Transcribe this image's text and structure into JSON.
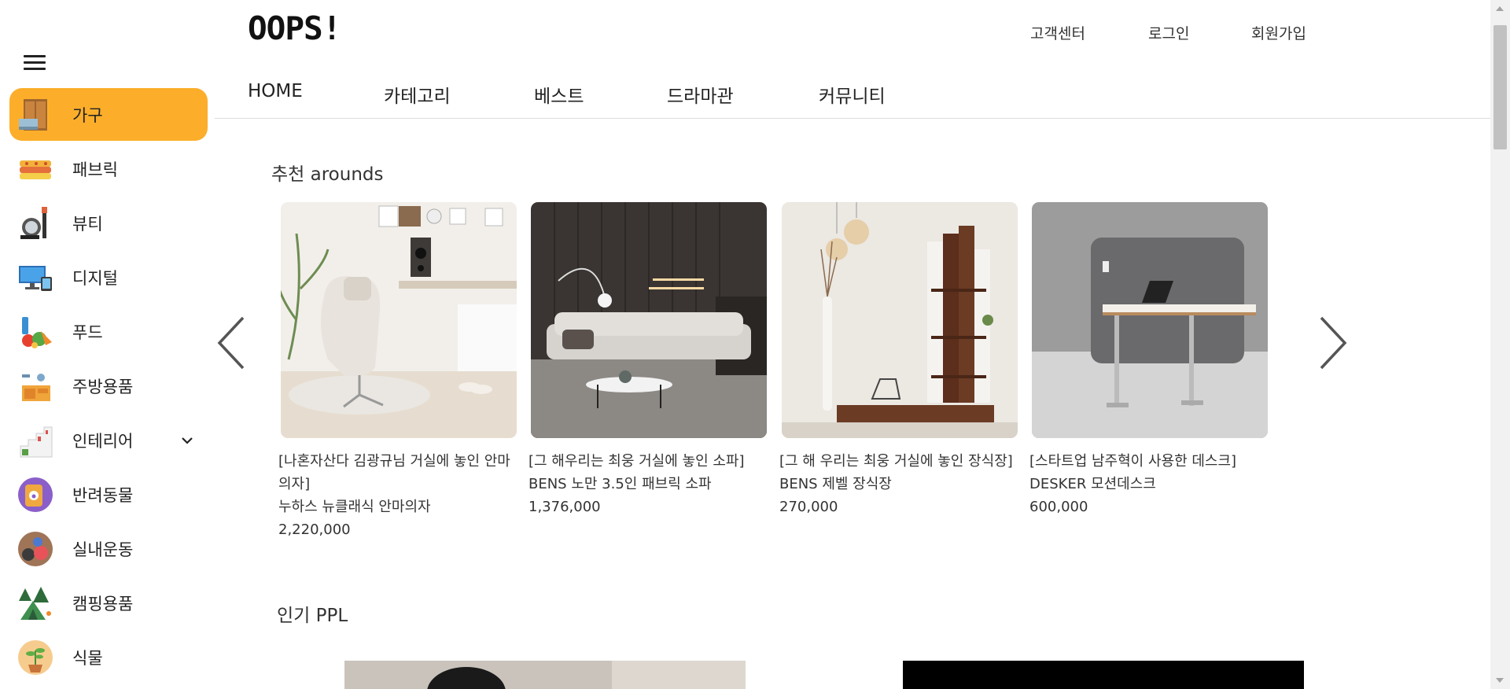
{
  "header": {
    "logo": "OOPS!",
    "util_links": [
      "고객센터",
      "로그인",
      "회원가입"
    ],
    "nav": [
      "HOME",
      "카테고리",
      "베스트",
      "드라마관",
      "커뮤니티"
    ]
  },
  "sidebar": {
    "items": [
      {
        "label": "가구",
        "icon": "furniture-icon",
        "active": true
      },
      {
        "label": "패브릭",
        "icon": "fabric-icon"
      },
      {
        "label": "뷰티",
        "icon": "beauty-icon"
      },
      {
        "label": "디지털",
        "icon": "digital-icon"
      },
      {
        "label": "푸드",
        "icon": "food-icon"
      },
      {
        "label": "주방용품",
        "icon": "kitchen-icon"
      },
      {
        "label": "인테리어",
        "icon": "interior-icon",
        "expandable": true
      },
      {
        "label": "반려동물",
        "icon": "pet-icon"
      },
      {
        "label": "실내운동",
        "icon": "exercise-icon"
      },
      {
        "label": "캠핑용품",
        "icon": "camping-icon"
      },
      {
        "label": "식물",
        "icon": "plant-icon"
      }
    ]
  },
  "recommend": {
    "title": "추천 arounds",
    "products": [
      {
        "tag": "[나혼자산다 김광규님 거실에 놓인 안마의자]",
        "name": "누하스 뉴클래식 안마의자",
        "price": "2,220,000"
      },
      {
        "tag": "[그 해우리는 최웅 거실에 놓인 소파]",
        "name": "BENS 노만 3.5인 패브릭 소파",
        "price": "1,376,000"
      },
      {
        "tag": "[그 해 우리는 최웅 거실에 놓인 장식장]",
        "name": "BENS 제벨 장식장",
        "price": "270,000"
      },
      {
        "tag": "[스타트업 남주혁이 사용한 데스크]",
        "name": "DESKER 모션데스크",
        "price": "600,000"
      }
    ]
  },
  "ppl": {
    "title": "인기 PPL"
  },
  "colors": {
    "accent": "#fcae2b"
  }
}
